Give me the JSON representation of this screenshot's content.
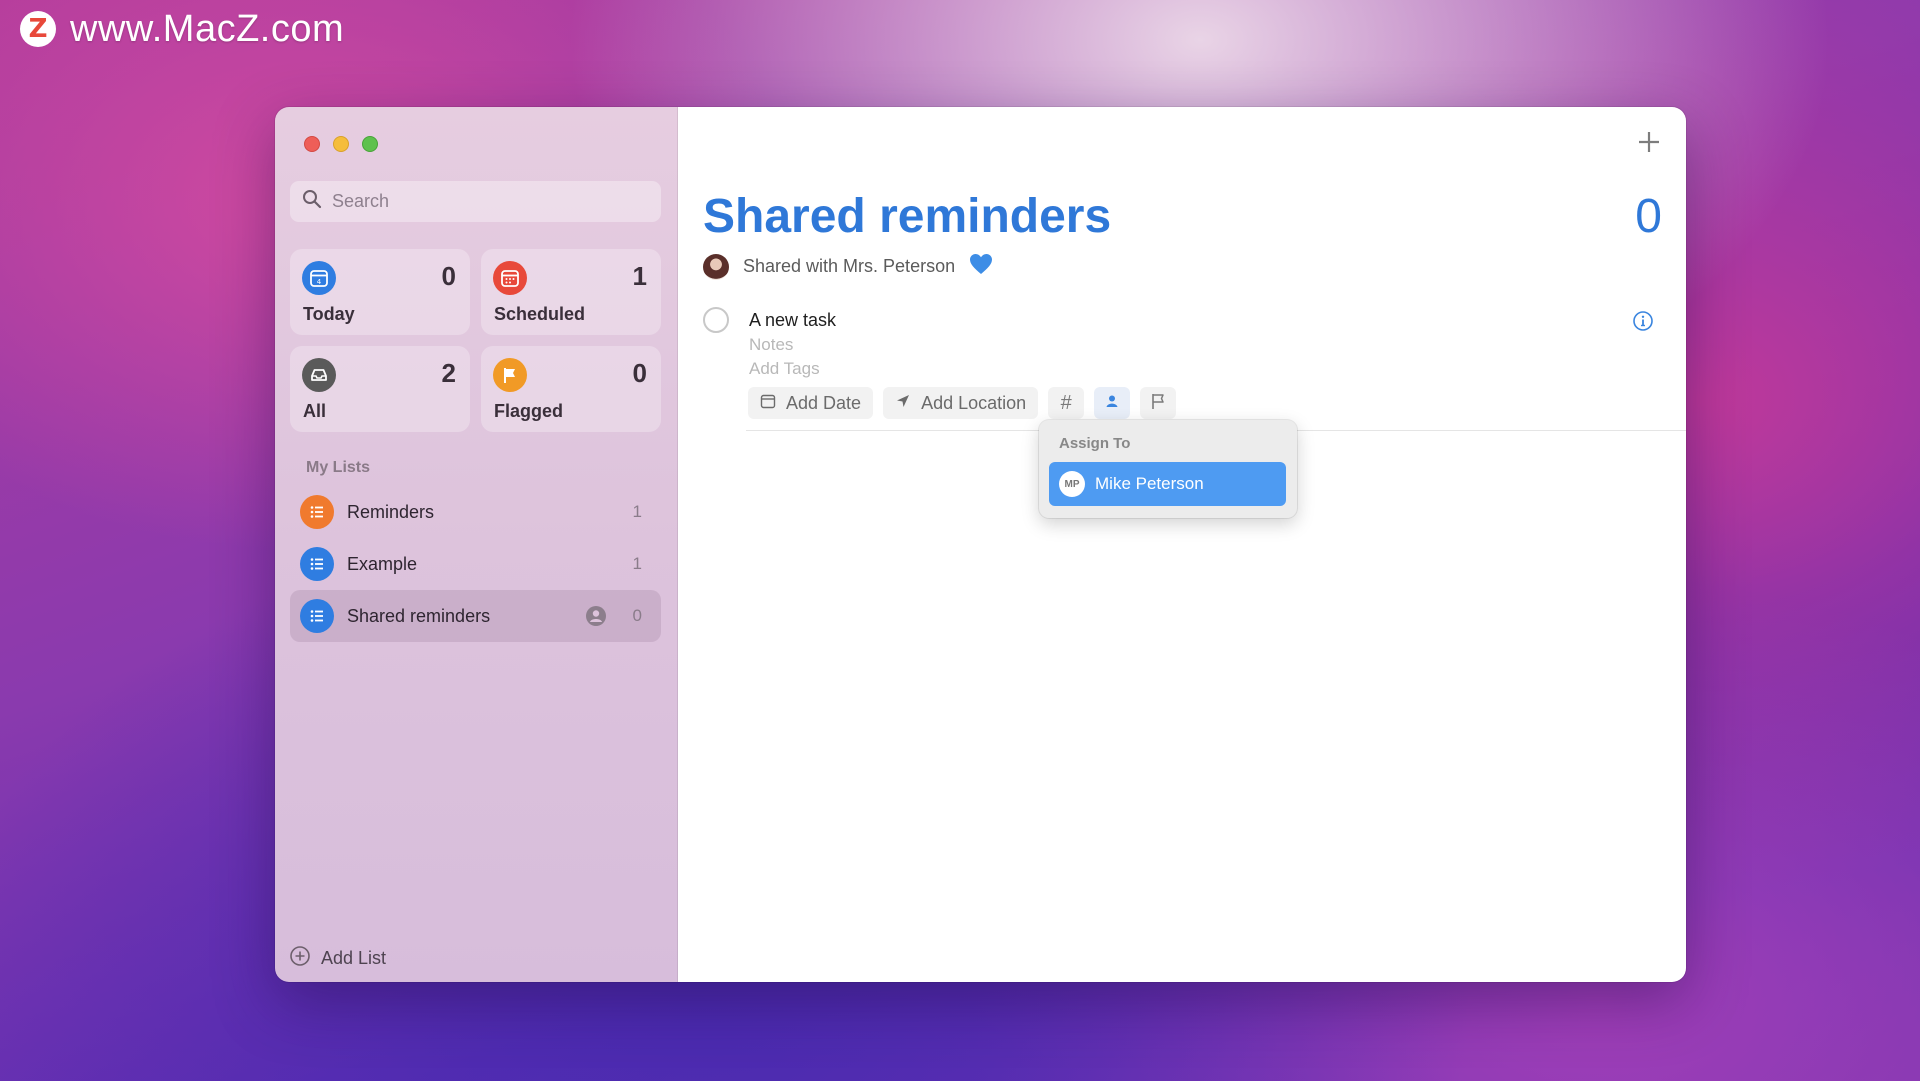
{
  "watermark": {
    "logo": "Z",
    "text": "www.MacZ.com"
  },
  "colors": {
    "accent": "#2f78d8",
    "today": "#2f7de1",
    "scheduled": "#e8493a",
    "all": "#5a5a5a",
    "flagged": "#f19a26",
    "reminders_list": "#f07a2e",
    "blue_list": "#2f7de1",
    "popup_highlight": "#4e9bf2"
  },
  "sidebar": {
    "search_placeholder": "Search",
    "tiles": [
      {
        "label": "Today",
        "count": "0",
        "icon": "calendar-today-icon"
      },
      {
        "label": "Scheduled",
        "count": "1",
        "icon": "calendar-scheduled-icon"
      },
      {
        "label": "All",
        "count": "2",
        "icon": "tray-icon"
      },
      {
        "label": "Flagged",
        "count": "0",
        "icon": "flag-icon"
      }
    ],
    "my_lists_title": "My Lists",
    "lists": [
      {
        "label": "Reminders",
        "count": "1",
        "icon": "list-bullet-icon"
      },
      {
        "label": "Example",
        "count": "1",
        "icon": "list-bullet-icon"
      },
      {
        "label": "Shared reminders",
        "count": "0",
        "icon": "list-bullet-icon",
        "shared": true
      }
    ],
    "add_list_label": "Add List"
  },
  "main": {
    "title": "Shared reminders",
    "count": "0",
    "shared_text": "Shared with Mrs. Peterson",
    "task": {
      "title": "A new task",
      "notes_placeholder": "Notes",
      "tags_placeholder": "Add Tags"
    },
    "chips": {
      "add_date": "Add Date",
      "add_location": "Add Location",
      "tag": "#"
    },
    "assign_popup": {
      "title": "Assign To",
      "initials": "MP",
      "person": "Mike Peterson"
    }
  }
}
